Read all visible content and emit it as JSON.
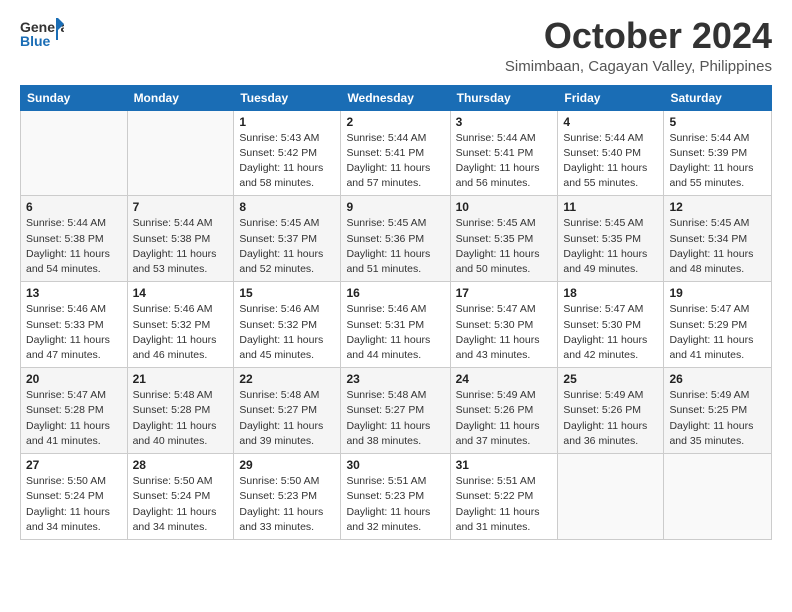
{
  "header": {
    "logo_general": "General",
    "logo_blue": "Blue",
    "month_title": "October 2024",
    "subtitle": "Simimbaan, Cagayan Valley, Philippines"
  },
  "weekdays": [
    "Sunday",
    "Monday",
    "Tuesday",
    "Wednesday",
    "Thursday",
    "Friday",
    "Saturday"
  ],
  "weeks": [
    [
      {
        "day": "",
        "detail": ""
      },
      {
        "day": "",
        "detail": ""
      },
      {
        "day": "1",
        "detail": "Sunrise: 5:43 AM\nSunset: 5:42 PM\nDaylight: 11 hours\nand 58 minutes."
      },
      {
        "day": "2",
        "detail": "Sunrise: 5:44 AM\nSunset: 5:41 PM\nDaylight: 11 hours\nand 57 minutes."
      },
      {
        "day": "3",
        "detail": "Sunrise: 5:44 AM\nSunset: 5:41 PM\nDaylight: 11 hours\nand 56 minutes."
      },
      {
        "day": "4",
        "detail": "Sunrise: 5:44 AM\nSunset: 5:40 PM\nDaylight: 11 hours\nand 55 minutes."
      },
      {
        "day": "5",
        "detail": "Sunrise: 5:44 AM\nSunset: 5:39 PM\nDaylight: 11 hours\nand 55 minutes."
      }
    ],
    [
      {
        "day": "6",
        "detail": "Sunrise: 5:44 AM\nSunset: 5:38 PM\nDaylight: 11 hours\nand 54 minutes."
      },
      {
        "day": "7",
        "detail": "Sunrise: 5:44 AM\nSunset: 5:38 PM\nDaylight: 11 hours\nand 53 minutes."
      },
      {
        "day": "8",
        "detail": "Sunrise: 5:45 AM\nSunset: 5:37 PM\nDaylight: 11 hours\nand 52 minutes."
      },
      {
        "day": "9",
        "detail": "Sunrise: 5:45 AM\nSunset: 5:36 PM\nDaylight: 11 hours\nand 51 minutes."
      },
      {
        "day": "10",
        "detail": "Sunrise: 5:45 AM\nSunset: 5:35 PM\nDaylight: 11 hours\nand 50 minutes."
      },
      {
        "day": "11",
        "detail": "Sunrise: 5:45 AM\nSunset: 5:35 PM\nDaylight: 11 hours\nand 49 minutes."
      },
      {
        "day": "12",
        "detail": "Sunrise: 5:45 AM\nSunset: 5:34 PM\nDaylight: 11 hours\nand 48 minutes."
      }
    ],
    [
      {
        "day": "13",
        "detail": "Sunrise: 5:46 AM\nSunset: 5:33 PM\nDaylight: 11 hours\nand 47 minutes."
      },
      {
        "day": "14",
        "detail": "Sunrise: 5:46 AM\nSunset: 5:32 PM\nDaylight: 11 hours\nand 46 minutes."
      },
      {
        "day": "15",
        "detail": "Sunrise: 5:46 AM\nSunset: 5:32 PM\nDaylight: 11 hours\nand 45 minutes."
      },
      {
        "day": "16",
        "detail": "Sunrise: 5:46 AM\nSunset: 5:31 PM\nDaylight: 11 hours\nand 44 minutes."
      },
      {
        "day": "17",
        "detail": "Sunrise: 5:47 AM\nSunset: 5:30 PM\nDaylight: 11 hours\nand 43 minutes."
      },
      {
        "day": "18",
        "detail": "Sunrise: 5:47 AM\nSunset: 5:30 PM\nDaylight: 11 hours\nand 42 minutes."
      },
      {
        "day": "19",
        "detail": "Sunrise: 5:47 AM\nSunset: 5:29 PM\nDaylight: 11 hours\nand 41 minutes."
      }
    ],
    [
      {
        "day": "20",
        "detail": "Sunrise: 5:47 AM\nSunset: 5:28 PM\nDaylight: 11 hours\nand 41 minutes."
      },
      {
        "day": "21",
        "detail": "Sunrise: 5:48 AM\nSunset: 5:28 PM\nDaylight: 11 hours\nand 40 minutes."
      },
      {
        "day": "22",
        "detail": "Sunrise: 5:48 AM\nSunset: 5:27 PM\nDaylight: 11 hours\nand 39 minutes."
      },
      {
        "day": "23",
        "detail": "Sunrise: 5:48 AM\nSunset: 5:27 PM\nDaylight: 11 hours\nand 38 minutes."
      },
      {
        "day": "24",
        "detail": "Sunrise: 5:49 AM\nSunset: 5:26 PM\nDaylight: 11 hours\nand 37 minutes."
      },
      {
        "day": "25",
        "detail": "Sunrise: 5:49 AM\nSunset: 5:26 PM\nDaylight: 11 hours\nand 36 minutes."
      },
      {
        "day": "26",
        "detail": "Sunrise: 5:49 AM\nSunset: 5:25 PM\nDaylight: 11 hours\nand 35 minutes."
      }
    ],
    [
      {
        "day": "27",
        "detail": "Sunrise: 5:50 AM\nSunset: 5:24 PM\nDaylight: 11 hours\nand 34 minutes."
      },
      {
        "day": "28",
        "detail": "Sunrise: 5:50 AM\nSunset: 5:24 PM\nDaylight: 11 hours\nand 34 minutes."
      },
      {
        "day": "29",
        "detail": "Sunrise: 5:50 AM\nSunset: 5:23 PM\nDaylight: 11 hours\nand 33 minutes."
      },
      {
        "day": "30",
        "detail": "Sunrise: 5:51 AM\nSunset: 5:23 PM\nDaylight: 11 hours\nand 32 minutes."
      },
      {
        "day": "31",
        "detail": "Sunrise: 5:51 AM\nSunset: 5:22 PM\nDaylight: 11 hours\nand 31 minutes."
      },
      {
        "day": "",
        "detail": ""
      },
      {
        "day": "",
        "detail": ""
      }
    ]
  ]
}
